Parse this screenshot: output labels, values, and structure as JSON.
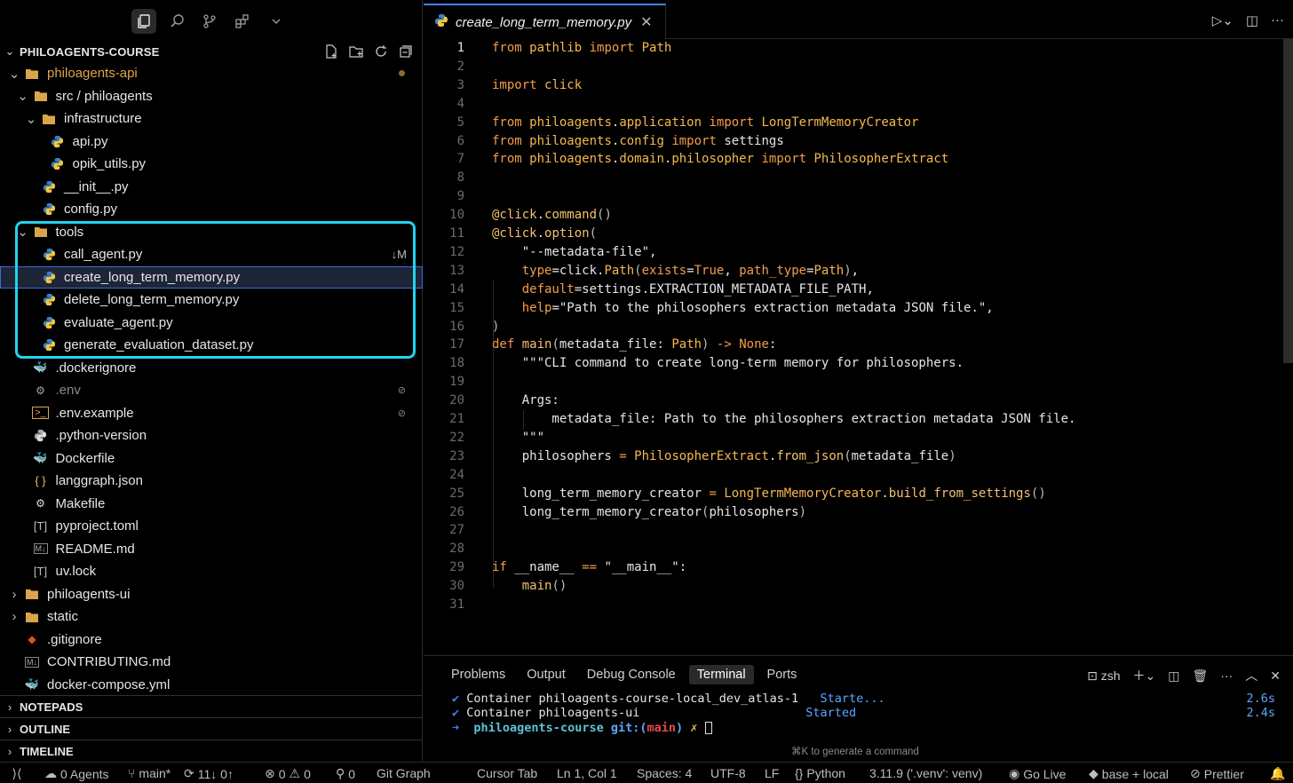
{
  "explorer": {
    "title": "PHILOAGENTS-COURSE",
    "items": [
      {
        "label": "philoagents-api",
        "kind": "folder-open"
      },
      {
        "label": "src / philoagents",
        "kind": "folder-open"
      },
      {
        "label": "infrastructure",
        "kind": "folder-open"
      },
      {
        "label": "api.py",
        "kind": "python"
      },
      {
        "label": "opik_utils.py",
        "kind": "python"
      },
      {
        "label": "__init__.py",
        "kind": "python"
      },
      {
        "label": "config.py",
        "kind": "python"
      },
      {
        "label": "tools",
        "kind": "folder-open"
      },
      {
        "label": "call_agent.py",
        "kind": "python",
        "badge": "↓M"
      },
      {
        "label": "create_long_term_memory.py",
        "kind": "python"
      },
      {
        "label": "delete_long_term_memory.py",
        "kind": "python"
      },
      {
        "label": "evaluate_agent.py",
        "kind": "python"
      },
      {
        "label": "generate_evaluation_dataset.py",
        "kind": "python"
      },
      {
        "label": ".dockerignore",
        "kind": "docker"
      },
      {
        "label": ".env",
        "kind": "gear"
      },
      {
        "label": ".env.example",
        "kind": "terminal"
      },
      {
        "label": ".python-version",
        "kind": "python-gray"
      },
      {
        "label": "Dockerfile",
        "kind": "docker"
      },
      {
        "label": "langgraph.json",
        "kind": "json"
      },
      {
        "label": "Makefile",
        "kind": "makefile"
      },
      {
        "label": "pyproject.toml",
        "kind": "toml"
      },
      {
        "label": "README.md",
        "kind": "markdown"
      },
      {
        "label": "uv.lock",
        "kind": "toml"
      },
      {
        "label": "philoagents-ui",
        "kind": "folder"
      },
      {
        "label": "static",
        "kind": "folder"
      },
      {
        "label": ".gitignore",
        "kind": "git"
      },
      {
        "label": "CONTRIBUTING.md",
        "kind": "markdown"
      },
      {
        "label": "docker-compose.yml",
        "kind": "docker"
      }
    ],
    "panels": [
      "NOTEPADS",
      "OUTLINE",
      "TIMELINE"
    ]
  },
  "editor": {
    "tab_title": "create_long_term_memory.py",
    "line_numbers": [
      "1",
      "2",
      "3",
      "4",
      "5",
      "6",
      "7",
      "8",
      "9",
      "10",
      "11",
      "12",
      "13",
      "14",
      "15",
      "16",
      "17",
      "18",
      "19",
      "20",
      "21",
      "22",
      "23",
      "24",
      "25",
      "26",
      "27",
      "28",
      "29",
      "30",
      "31"
    ]
  },
  "terminal": {
    "tabs": [
      "Problems",
      "Output",
      "Debug Console",
      "Terminal",
      "Ports"
    ],
    "shell": "zsh",
    "line1": "Container philoagents-course-local_dev_atlas-1",
    "line1_status": "Starte...",
    "line1_time": "2.6s",
    "line2": "Container philoagents-ui",
    "line2_status": "Started",
    "line2_time": "2.4s",
    "prompt_dir": "philoagents-course",
    "prompt_git": "git:",
    "prompt_branch": "main",
    "hint": "⌘K to generate a command"
  },
  "status_bar": {
    "agents": "0 Agents",
    "branch": "main*",
    "sync": "11↓ 0↑",
    "errors": "0",
    "warnings": "0",
    "ports": "0",
    "git_graph": "Git Graph",
    "cursor_tab": "Cursor Tab",
    "position": "Ln 1, Col 1",
    "spaces": "Spaces: 4",
    "encoding": "UTF-8",
    "eol": "LF",
    "language": "Python",
    "interpreter": "3.11.9 ('.venv': venv)",
    "go_live": "Go Live",
    "env": "base + local",
    "prettier": "Prettier"
  }
}
